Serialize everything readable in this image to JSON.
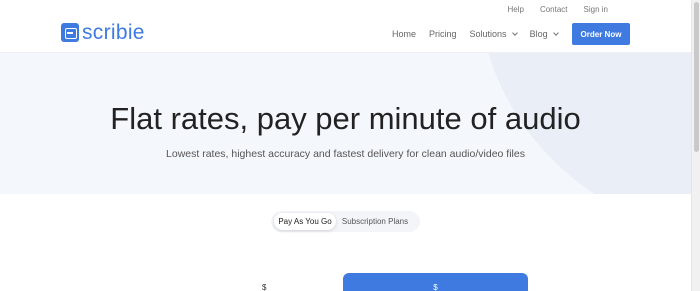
{
  "utility_nav": {
    "help": "Help",
    "contact": "Contact",
    "signin": "Sign in"
  },
  "brand": {
    "name": "scribie",
    "color": "#3f7ae0"
  },
  "nav": {
    "home": "Home",
    "pricing": "Pricing",
    "solutions": "Solutions",
    "blog": "Blog",
    "order_button": "Order Now"
  },
  "hero": {
    "title": "Flat rates, pay per minute of audio",
    "subtitle": "Lowest rates, highest accuracy and fastest delivery for clean audio/video files"
  },
  "toggle": {
    "selected": "Pay As You Go",
    "options": [
      "Pay As You Go",
      "Subscription Plans"
    ]
  },
  "cards": {
    "left_currency": "$",
    "right_currency": "$"
  },
  "icons": {
    "logo": "scribie-logo-icon",
    "chevron": "chevron-down-icon"
  }
}
